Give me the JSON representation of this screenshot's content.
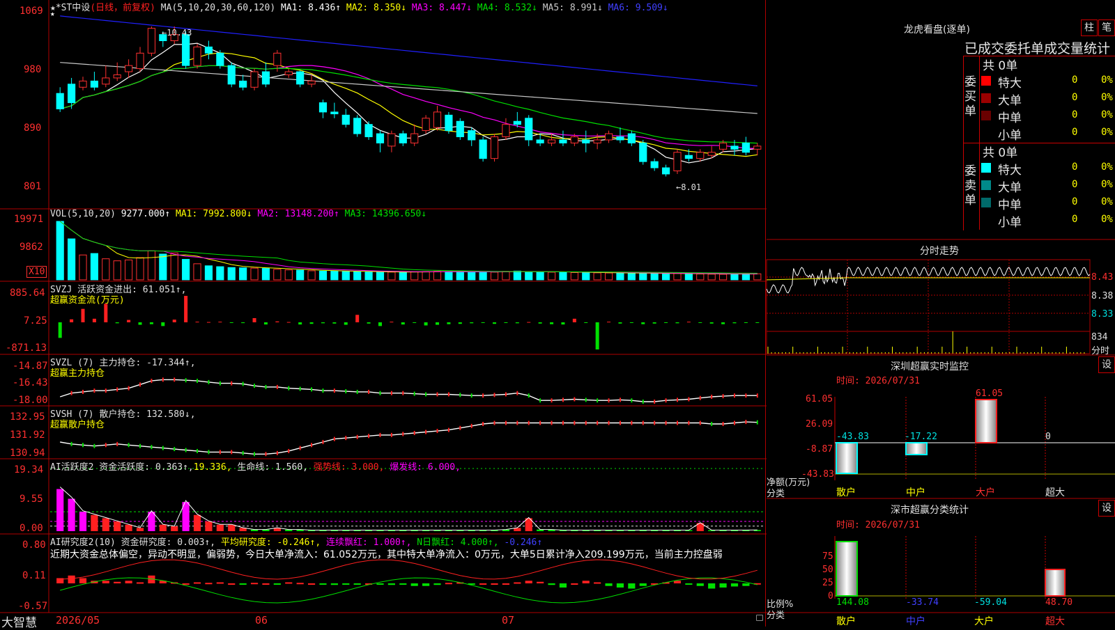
{
  "main_header": {
    "name": "★*ST中设",
    "period": "(日线，前复权)",
    "ma_params": "MA(5,10,20,30,60,120)",
    "ma1": "MA1: 8.436↑",
    "ma2": "MA2: 8.350↓",
    "ma3": "MA3: 8.447↓",
    "ma4": "MA4: 8.532↓",
    "ma5": "MA5: 8.991↓",
    "ma6": "MA6: 9.509↓",
    "y_ticks": [
      "1069",
      "980",
      "890",
      "801"
    ],
    "high_mark": "←10.43",
    "low_mark": "←8.01",
    "star": "★"
  },
  "vol_panel": {
    "header": "VOL(5,10,20)",
    "value": "9277.000↑",
    "ma1": "MA1: 7992.800↓",
    "ma2": "MA2: 13148.200↑",
    "ma3": "MA3: 14396.650↓",
    "y_ticks": [
      "19971",
      "9862"
    ],
    "unit": "X10"
  },
  "svzj_panel": {
    "header": "SVZJ  活跃资金进出: 61.051↑,",
    "sub": "超赢资金流(万元)",
    "y_ticks": [
      "885.64",
      "7.25",
      "-871.13"
    ]
  },
  "svzl_panel": {
    "header": "SVZL (7) 主力持仓: -17.344↑,",
    "sub": "超赢主力持仓",
    "y_ticks": [
      "-14.87",
      "-16.43",
      "-18.00"
    ]
  },
  "svsh_panel": {
    "header": "SVSH (7) 散户持仓: 132.580↓,",
    "sub": "超赢散户持仓",
    "y_ticks": [
      "132.95",
      "131.92",
      "130.94"
    ]
  },
  "ai_active_panel": {
    "h1": "AI活跃度2 资金活跃度: 0.363↑,",
    "h2": "19.336,",
    "h3": "生命线: 1.560,",
    "h4": "强势线: 3.000,",
    "h5": "爆发线: 6.000,",
    "y_ticks": [
      "19.34",
      "9.55",
      "0.00"
    ]
  },
  "ai_research_panel": {
    "h1": "AI研究度2(10) 资金研究度: 0.003↑,",
    "h2": "平均研究度: -0.246↑,",
    "h3": "连续飘红: 1.000↑,",
    "h4": "N日飘红: 4.000↑,",
    "h5": "-0.246↑",
    "commentary": "近期大资金总体偏空，异动不明显，偏弱势，今日大单净流入：61.052万元，其中特大单净流入：0万元，大单5日累计净入209.199万元，当前主力控盘弱",
    "y_ticks": [
      "0.80",
      "0.11",
      "-0.57"
    ]
  },
  "x_axis": {
    "brand": "大智慧",
    "labels": [
      "2026/05",
      "06",
      "07"
    ]
  },
  "right_panel": {
    "dragon_title": "龙虎看盘(逐单)",
    "btn1": "柱",
    "btn2": "笔",
    "stats_title": "已成交委托单成交量统计",
    "buy_label": "委买单",
    "sell_label": "委卖单",
    "buy_total": "共 0单",
    "sell_total": "共 0单",
    "buy_rows": [
      {
        "name": "特大",
        "count": "0",
        "pct": "0%",
        "color": "#ff0000"
      },
      {
        "name": "大单",
        "count": "0",
        "pct": "0%",
        "color": "#9a0000"
      },
      {
        "name": "中单",
        "count": "0",
        "pct": "0%",
        "color": "#6a0000"
      },
      {
        "name": "小单",
        "count": "0",
        "pct": "0%",
        "color": "#000000"
      }
    ],
    "sell_rows": [
      {
        "name": "特大",
        "count": "0",
        "pct": "0%",
        "color": "#00ffff"
      },
      {
        "name": "大单",
        "count": "0",
        "pct": "0%",
        "color": "#008a8a"
      },
      {
        "name": "中单",
        "count": "0",
        "pct": "0%",
        "color": "#006a6a"
      },
      {
        "name": "小单",
        "count": "0",
        "pct": "0%",
        "color": "#000000"
      }
    ],
    "intraday_title": "分时走势",
    "intraday_ticks": [
      "8.43",
      "8.38",
      "8.33",
      "834",
      "分时"
    ],
    "monitor_title": "深圳超赢实时监控",
    "monitor_btn": "设",
    "monitor_time": "时间: 2026/07/31",
    "monitor_ticks": [
      "61.05",
      "26.09",
      "-8.87",
      "-43.83"
    ],
    "monitor_unit1": "净额(万元)",
    "monitor_unit2": "分类",
    "monitor_values": [
      "-43.83",
      "-17.22",
      "61.05",
      "0"
    ],
    "monitor_cats": [
      "散户",
      "中户",
      "大户",
      "超大"
    ],
    "class_title": "深市超赢分类统计",
    "class_btn": "设",
    "class_time": "时间: 2026/07/31",
    "class_ticks": [
      "75",
      "50",
      "25",
      "0"
    ],
    "class_unit1": "比例%",
    "class_unit2": "分类",
    "class_values": [
      "144.08",
      "-33.74",
      "-59.04",
      "48.70"
    ],
    "class_cats": [
      "散户",
      "中户",
      "大户",
      "超大"
    ]
  },
  "chart_data": [
    {
      "type": "candlestick",
      "title": "★*ST中设 (日线，前复权)",
      "x_labels": [
        "2026/05",
        "06",
        "07"
      ],
      "ylim": [
        7.6,
        10.7
      ],
      "candles": [
        [
          9.35,
          9.1,
          9.45,
          9.05
        ],
        [
          9.5,
          9.2,
          9.6,
          9.1
        ],
        [
          9.45,
          9.55,
          9.62,
          9.4
        ],
        [
          9.55,
          9.45,
          9.7,
          9.4
        ],
        [
          9.5,
          9.6,
          9.8,
          9.45
        ],
        [
          9.6,
          9.65,
          9.85,
          9.55
        ],
        [
          9.7,
          9.8,
          9.9,
          9.6
        ],
        [
          9.75,
          10.0,
          10.1,
          9.7
        ],
        [
          10.0,
          10.4,
          10.43,
          9.95
        ],
        [
          10.3,
          10.2,
          10.35,
          10.1
        ],
        [
          10.2,
          10.3,
          10.43,
          10.15
        ],
        [
          10.3,
          9.8,
          10.35,
          9.75
        ],
        [
          9.8,
          10.1,
          10.15,
          9.75
        ],
        [
          10.1,
          10.0,
          10.2,
          9.9
        ],
        [
          10.0,
          9.8,
          10.05,
          9.75
        ],
        [
          9.8,
          9.5,
          9.85,
          9.45
        ],
        [
          9.55,
          9.45,
          9.65,
          9.4
        ],
        [
          9.45,
          9.7,
          9.75,
          9.4
        ],
        [
          9.7,
          9.5,
          9.85,
          9.45
        ],
        [
          9.8,
          10.0,
          10.05,
          9.7
        ],
        [
          9.65,
          9.7,
          9.75,
          9.6
        ],
        [
          9.7,
          9.5,
          9.72,
          9.45
        ],
        [
          9.5,
          9.55,
          9.65,
          9.45
        ],
        [
          9.2,
          9.05,
          9.25,
          8.95
        ],
        [
          9.05,
          9.02,
          9.2,
          8.95
        ],
        [
          9.0,
          8.85,
          9.1,
          8.8
        ],
        [
          8.95,
          8.7,
          9.0,
          8.65
        ],
        [
          8.85,
          8.65,
          8.9,
          8.6
        ],
        [
          8.7,
          8.55,
          8.75,
          8.4
        ],
        [
          8.5,
          8.7,
          8.75,
          8.4
        ],
        [
          8.7,
          8.55,
          8.75,
          8.5
        ],
        [
          8.55,
          8.7,
          8.85,
          8.5
        ],
        [
          8.75,
          8.95,
          9.0,
          8.7
        ],
        [
          8.8,
          9.05,
          9.15,
          8.75
        ],
        [
          9.0,
          8.75,
          9.05,
          8.7
        ],
        [
          8.9,
          8.65,
          8.95,
          8.6
        ],
        [
          8.75,
          8.6,
          8.8,
          8.5
        ],
        [
          8.6,
          8.3,
          8.65,
          8.25
        ],
        [
          8.3,
          8.65,
          8.7,
          8.25
        ],
        [
          8.65,
          8.85,
          8.95,
          8.6
        ],
        [
          8.9,
          8.85,
          9.05,
          8.8
        ],
        [
          8.95,
          8.6,
          9.0,
          8.5
        ],
        [
          8.6,
          8.55,
          8.7,
          8.5
        ],
        [
          8.55,
          8.6,
          8.7,
          8.5
        ],
        [
          8.6,
          8.55,
          8.75,
          8.5
        ],
        [
          8.55,
          8.65,
          8.7,
          8.5
        ],
        [
          8.6,
          8.55,
          8.75,
          8.4
        ],
        [
          8.55,
          8.6,
          8.7,
          8.45
        ],
        [
          8.6,
          8.7,
          8.75,
          8.55
        ],
        [
          8.65,
          8.6,
          8.8,
          8.55
        ],
        [
          8.7,
          8.55,
          8.75,
          8.5
        ],
        [
          8.55,
          8.25,
          8.6,
          8.2
        ],
        [
          8.25,
          8.15,
          8.3,
          8.1
        ],
        [
          8.15,
          8.05,
          8.2,
          8.01
        ],
        [
          8.1,
          8.4,
          8.45,
          8.05
        ],
        [
          8.35,
          8.3,
          8.45,
          8.25
        ],
        [
          8.3,
          8.4,
          8.45,
          8.25
        ],
        [
          8.35,
          8.4,
          8.5,
          8.3
        ],
        [
          8.45,
          8.55,
          8.6,
          8.4
        ],
        [
          8.5,
          8.45,
          8.6,
          8.35
        ],
        [
          8.55,
          8.4,
          8.65,
          8.35
        ],
        [
          8.45,
          8.5,
          8.55,
          8.35
        ]
      ],
      "ma_series": [
        {
          "name": "MA1",
          "color": "#ffffff"
        },
        {
          "name": "MA2",
          "color": "#ffff00"
        },
        {
          "name": "MA3",
          "color": "#ff00ff"
        },
        {
          "name": "MA4",
          "color": "#00e000"
        },
        {
          "name": "MA5",
          "color": "#c8c8c8"
        },
        {
          "name": "MA6",
          "color": "#2020ff"
        }
      ]
    },
    {
      "type": "bar",
      "title": "VOL(5,10,20)",
      "values": [
        19971,
        14000,
        8500,
        9000,
        7200,
        6500,
        6800,
        7600,
        9900,
        8800,
        9200,
        7000,
        5500,
        4800,
        4500,
        4200,
        4100,
        4000,
        3900,
        3600,
        3400,
        3300,
        3100,
        3000,
        2950,
        2900,
        2800,
        2700,
        2600,
        2650,
        2700,
        2750,
        2800,
        2900,
        2850,
        2800,
        2700,
        2600,
        2650,
        2900,
        3000,
        2800,
        2700,
        2600,
        2650,
        2500,
        2450,
        2400,
        2350,
        2300,
        2250,
        2200,
        2150,
        2100,
        2200,
        2100,
        2000,
        1950,
        1900,
        2000,
        2100,
        2050
      ],
      "ylim": [
        0,
        19971
      ]
    },
    {
      "type": "bar",
      "title": "SVZJ 活跃资金进出",
      "values": [
        -500,
        100,
        450,
        120,
        620,
        -30,
        80,
        -80,
        -60,
        -120,
        90,
        885.64,
        20,
        10,
        20,
        -10,
        -25,
        140,
        -70,
        30,
        10,
        -70,
        -50,
        -30,
        -40,
        -80,
        250,
        -40,
        -120,
        20,
        -70,
        -20,
        -100,
        -80,
        -60,
        -50,
        -30,
        -20,
        -50,
        -20,
        -30,
        10,
        -40,
        -60,
        -70,
        120,
        -20,
        -871.13,
        20,
        -40,
        -20,
        -60,
        -40,
        -20,
        -30,
        20,
        -20,
        -40,
        -60,
        -30,
        -20,
        -10
      ],
      "ylim": [
        -871.13,
        885.64
      ]
    },
    {
      "type": "line",
      "title": "SVZL 主力持仓",
      "values": [
        -17.6,
        -17.3,
        -17.2,
        -17.1,
        -17.1,
        -17.0,
        -16.9,
        -16.6,
        -16.3,
        -16.2,
        -16.2,
        -16.25,
        -16.3,
        -16.4,
        -16.5,
        -16.5,
        -16.55,
        -16.7,
        -16.8,
        -16.8,
        -16.9,
        -16.95,
        -17.0,
        -17.1,
        -17.1,
        -17.15,
        -17.2,
        -17.2,
        -17.3,
        -17.3,
        -17.3,
        -17.35,
        -17.4,
        -17.4,
        -17.4,
        -17.45,
        -17.5,
        -17.5,
        -17.45,
        -17.4,
        -17.3,
        -17.5,
        -17.9,
        -17.9,
        -17.85,
        -17.8,
        -17.85,
        -17.9,
        -17.9,
        -17.85,
        -17.9,
        -18.0,
        -18.0,
        -17.9,
        -17.85,
        -17.8,
        -17.7,
        -17.6,
        -17.55,
        -17.5,
        -17.5,
        -17.5
      ],
      "ylim": [
        -18.0,
        -14.87
      ]
    },
    {
      "type": "line",
      "title": "SVSH 散户持仓",
      "values": [
        131.6,
        131.5,
        131.45,
        131.4,
        131.45,
        131.5,
        131.45,
        131.4,
        131.35,
        131.3,
        131.25,
        131.2,
        131.15,
        131.1,
        131.1,
        131.1,
        131.05,
        131.0,
        131.0,
        131.05,
        131.15,
        131.3,
        131.45,
        131.6,
        131.75,
        131.8,
        131.85,
        131.9,
        131.95,
        131.95,
        132.0,
        132.05,
        132.1,
        132.15,
        132.2,
        132.3,
        132.4,
        132.5,
        132.55,
        132.55,
        132.55,
        132.55,
        132.55,
        132.55,
        132.55,
        132.55,
        132.55,
        132.55,
        132.55,
        132.55,
        132.55,
        132.55,
        132.55,
        132.55,
        132.55,
        132.55,
        132.55,
        132.5,
        132.5,
        132.55,
        132.6,
        132.58
      ],
      "ylim": [
        130.94,
        132.95
      ]
    },
    {
      "type": "bar",
      "title": "AI活跃度2",
      "values": [
        13,
        10,
        6,
        5,
        4,
        3,
        2,
        1,
        6,
        2,
        1.5,
        9,
        5,
        3,
        2,
        2,
        1,
        0.5,
        0.5,
        1,
        0.5,
        0.5,
        0.3,
        0.3,
        0.3,
        0.3,
        0.3,
        0.3,
        0.3,
        0.3,
        0.3,
        0.3,
        0.3,
        0.3,
        0.3,
        0.3,
        0.3,
        0.3,
        0.3,
        0.5,
        1,
        4,
        0.5,
        0.5,
        0.3,
        0.3,
        0.3,
        0.3,
        0.3,
        0.3,
        0.3,
        0.3,
        0.3,
        0.3,
        0.3,
        0.3,
        2.5,
        0.3,
        0.3,
        0.3,
        0.3,
        0.363
      ],
      "ylim": [
        0,
        19.34
      ],
      "reference_lines": [
        {
          "name": "生命线",
          "value": 1.56
        },
        {
          "name": "强势线",
          "value": 3.0
        },
        {
          "name": "爆发线",
          "value": 6.0
        }
      ]
    },
    {
      "type": "bar",
      "title": "AI研究度2(10)",
      "values": [
        0.1,
        0.15,
        0.1,
        0.05,
        0.05,
        0.03,
        0.05,
        0.02,
        0.15,
        0.05,
        0.02,
        0.0,
        0.02,
        0.01,
        0.02,
        0.0,
        -0.02,
        0.01,
        0.0,
        -0.01,
        0.02,
        0.01,
        0.0,
        -0.02,
        -0.03,
        -0.02,
        -0.01,
        0.0,
        -0.02,
        -0.03,
        -0.02,
        -0.05,
        -0.05,
        -0.03,
        0.01,
        0.02,
        -0.02,
        0.0,
        0.0,
        0.0,
        0.02,
        0.05,
        0.03,
        -0.03,
        -0.08,
        0.0,
        0.05,
        0.02,
        -0.05,
        -0.08,
        -0.1,
        -0.05,
        0.0,
        0.02,
        0.05,
        -0.02,
        -0.05,
        -0.1,
        -0.08,
        -0.06,
        -0.05,
        0.003
      ],
      "ylim": [
        -0.57,
        0.8
      ]
    }
  ]
}
